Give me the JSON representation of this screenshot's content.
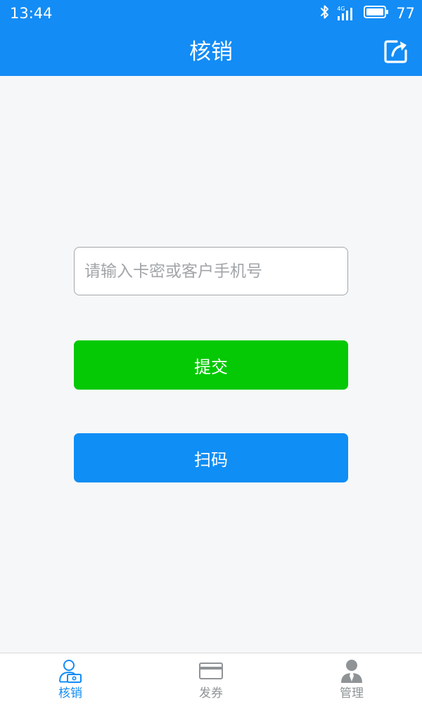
{
  "status_bar": {
    "time": "13:44",
    "network": "4G",
    "battery": "77",
    "icons": [
      "bluetooth-icon",
      "signal-icon",
      "battery-icon"
    ]
  },
  "app_bar": {
    "title": "核销",
    "action_icon": "share-icon"
  },
  "form": {
    "input_placeholder": "请输入卡密或客户手机号",
    "input_value": "",
    "submit_label": "提交",
    "scan_label": "扫码"
  },
  "bottom_nav": {
    "items": [
      {
        "label": "核销",
        "icon": "verify-user-icon",
        "active": true
      },
      {
        "label": "发券",
        "icon": "card-icon",
        "active": false
      },
      {
        "label": "管理",
        "icon": "manager-icon",
        "active": false
      }
    ]
  },
  "colors": {
    "primary": "#138cf5",
    "submit_green": "#04c904",
    "background": "#f6f7f8",
    "inactive_nav": "#8f9396"
  }
}
